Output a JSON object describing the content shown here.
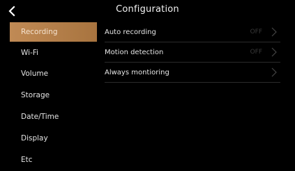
{
  "header": {
    "title": "Configuration",
    "back_icon": "chevron-left-icon"
  },
  "sidebar": {
    "items": [
      {
        "label": "Recording",
        "active": true
      },
      {
        "label": "Wi-Fi",
        "active": false
      },
      {
        "label": "Volume",
        "active": false
      },
      {
        "label": "Storage",
        "active": false
      },
      {
        "label": "Date/Time",
        "active": false
      },
      {
        "label": "Display",
        "active": false
      },
      {
        "label": "Etc",
        "active": false
      }
    ]
  },
  "settings": {
    "rows": [
      {
        "label": "Auto recording",
        "value": "OFF"
      },
      {
        "label": "Motion detection",
        "value": "OFF"
      },
      {
        "label": "Always montioring",
        "value": ""
      }
    ]
  },
  "colors": {
    "background": "#000000",
    "accent": "#b27d47",
    "text": "#e6e6e6",
    "muted": "#3a3a3a",
    "divider": "#2b2b2b"
  }
}
